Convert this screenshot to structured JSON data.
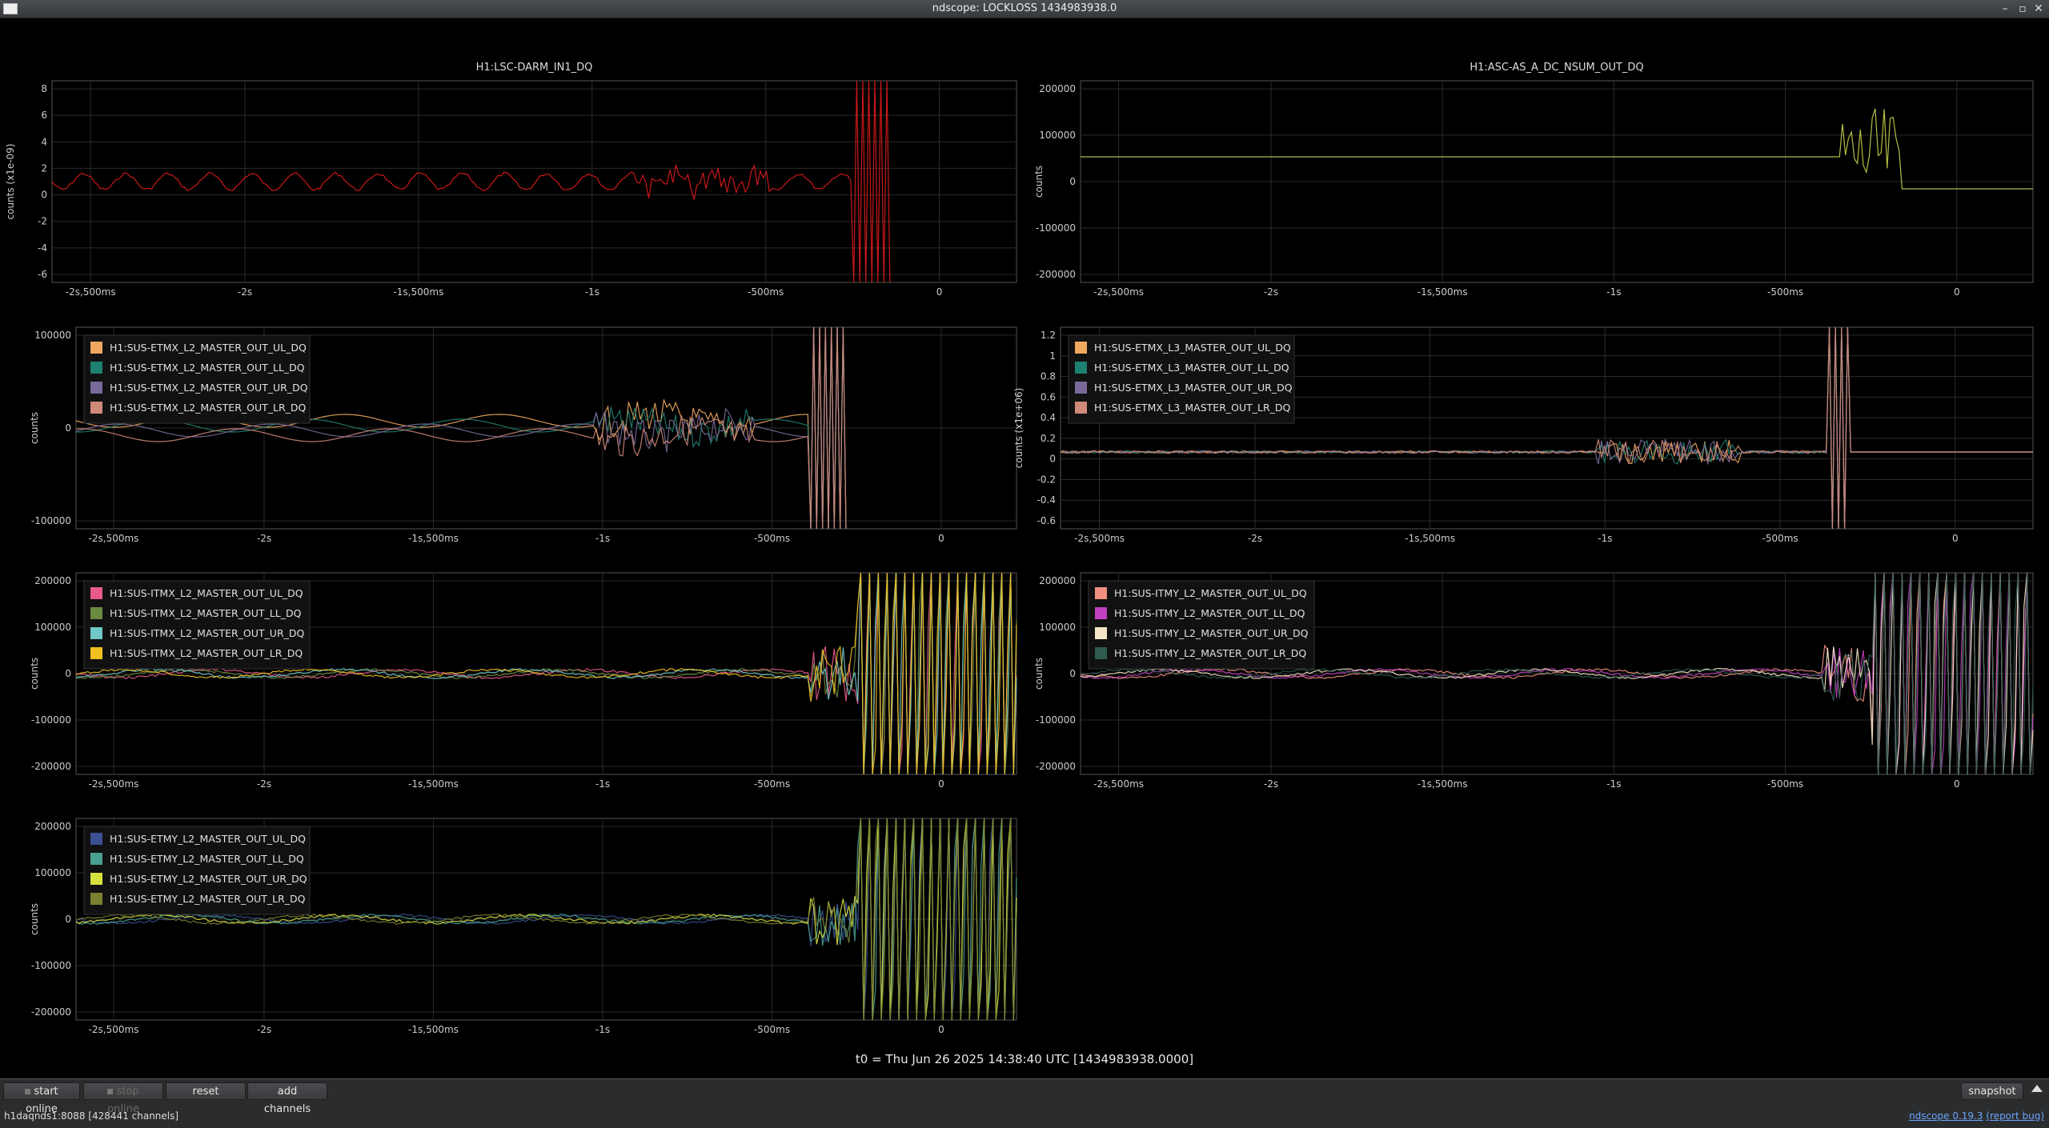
{
  "window": {
    "title": "ndscope: LOCKLOSS 1434983938.0",
    "min_icon": "minimize-icon",
    "max_icon": "maximize-icon",
    "close_icon": "close-icon"
  },
  "x_ticks": [
    "-2s,500ms",
    "-2s",
    "-1s,500ms",
    "-1s",
    "-500ms",
    "0"
  ],
  "plots": [
    {
      "id": "darm",
      "title": "H1:LSC-DARM_IN1_DQ",
      "ylabel": "counts (x1e-09)",
      "yticks": [
        "8",
        "6",
        "4",
        "2",
        "0",
        "-2",
        "-4",
        "-6"
      ],
      "legend": [],
      "series_colors": [
        "#e01b1b"
      ],
      "trace": "darm"
    },
    {
      "id": "asc",
      "title": "H1:ASC-AS_A_DC_NSUM_OUT_DQ",
      "ylabel": "counts",
      "yticks": [
        "200000",
        "100000",
        "0",
        "-100000",
        "-200000"
      ],
      "legend": [],
      "series_colors": [
        "#c8d24a"
      ],
      "trace": "asc"
    },
    {
      "id": "etmx_l2",
      "title": "",
      "ylabel": "counts",
      "yticks": [
        "100000",
        "0",
        "-100000"
      ],
      "legend": [
        "H1:SUS-ETMX_L2_MASTER_OUT_UL_DQ",
        "H1:SUS-ETMX_L2_MASTER_OUT_LL_DQ",
        "H1:SUS-ETMX_L2_MASTER_OUT_UR_DQ",
        "H1:SUS-ETMX_L2_MASTER_OUT_LR_DQ"
      ],
      "series_colors": [
        "#f0a860",
        "#1e8070",
        "#7a6a9a",
        "#d08a7a"
      ],
      "trace": "wobble"
    },
    {
      "id": "etmx_l3",
      "title": "",
      "ylabel": "counts (x1e+06)",
      "yticks": [
        "1.2",
        "1",
        "0.8",
        "0.6",
        "0.4",
        "0.2",
        "0",
        "-0.2",
        "-0.4",
        "-0.6"
      ],
      "legend": [
        "H1:SUS-ETMX_L3_MASTER_OUT_UL_DQ",
        "H1:SUS-ETMX_L3_MASTER_OUT_LL_DQ",
        "H1:SUS-ETMX_L3_MASTER_OUT_UR_DQ",
        "H1:SUS-ETMX_L3_MASTER_OUT_LR_DQ"
      ],
      "series_colors": [
        "#f0a860",
        "#1e8070",
        "#7a6a9a",
        "#d08a7a"
      ],
      "trace": "flat"
    },
    {
      "id": "itmx_l2",
      "title": "",
      "ylabel": "counts",
      "yticks": [
        "200000",
        "100000",
        "0",
        "-100000",
        "-200000"
      ],
      "legend": [
        "H1:SUS-ITMX_L2_MASTER_OUT_UL_DQ",
        "H1:SUS-ITMX_L2_MASTER_OUT_LL_DQ",
        "H1:SUS-ITMX_L2_MASTER_OUT_UR_DQ",
        "H1:SUS-ITMX_L2_MASTER_OUT_LR_DQ"
      ],
      "series_colors": [
        "#e85a8a",
        "#6a8a40",
        "#70c8c8",
        "#f0c020"
      ],
      "trace": "blowup"
    },
    {
      "id": "itmy_l2",
      "title": "",
      "ylabel": "counts",
      "yticks": [
        "200000",
        "100000",
        "0",
        "-100000",
        "-200000"
      ],
      "legend": [
        "H1:SUS-ITMY_L2_MASTER_OUT_UL_DQ",
        "H1:SUS-ITMY_L2_MASTER_OUT_LL_DQ",
        "H1:SUS-ITMY_L2_MASTER_OUT_UR_DQ",
        "H1:SUS-ITMY_L2_MASTER_OUT_LR_DQ"
      ],
      "series_colors": [
        "#f09080",
        "#c040c0",
        "#f5e6c8",
        "#2e5a50"
      ],
      "trace": "blowup"
    },
    {
      "id": "etmy_l2",
      "title": "",
      "ylabel": "counts",
      "yticks": [
        "200000",
        "100000",
        "0",
        "-100000",
        "-200000"
      ],
      "legend": [
        "H1:SUS-ETMY_L2_MASTER_OUT_UL_DQ",
        "H1:SUS-ETMY_L2_MASTER_OUT_LL_DQ",
        "H1:SUS-ETMY_L2_MASTER_OUT_UR_DQ",
        "H1:SUS-ETMY_L2_MASTER_OUT_LR_DQ"
      ],
      "series_colors": [
        "#3a5090",
        "#48a090",
        "#d8e040",
        "#7a8030"
      ],
      "trace": "blowup"
    }
  ],
  "t0_label": "t0 = Thu Jun 26 2025 14:38:40 UTC [1434983938.0000]",
  "buttons": {
    "start_online": "start online",
    "stop_online": "stop online",
    "reset": "reset",
    "add_channels": "add channels",
    "snapshot": "snapshot"
  },
  "status": "h1daqnds1:8088  [428441 channels]",
  "version": {
    "app": "ndscope",
    "number": "0.19.3",
    "report": "(report bug)"
  }
}
